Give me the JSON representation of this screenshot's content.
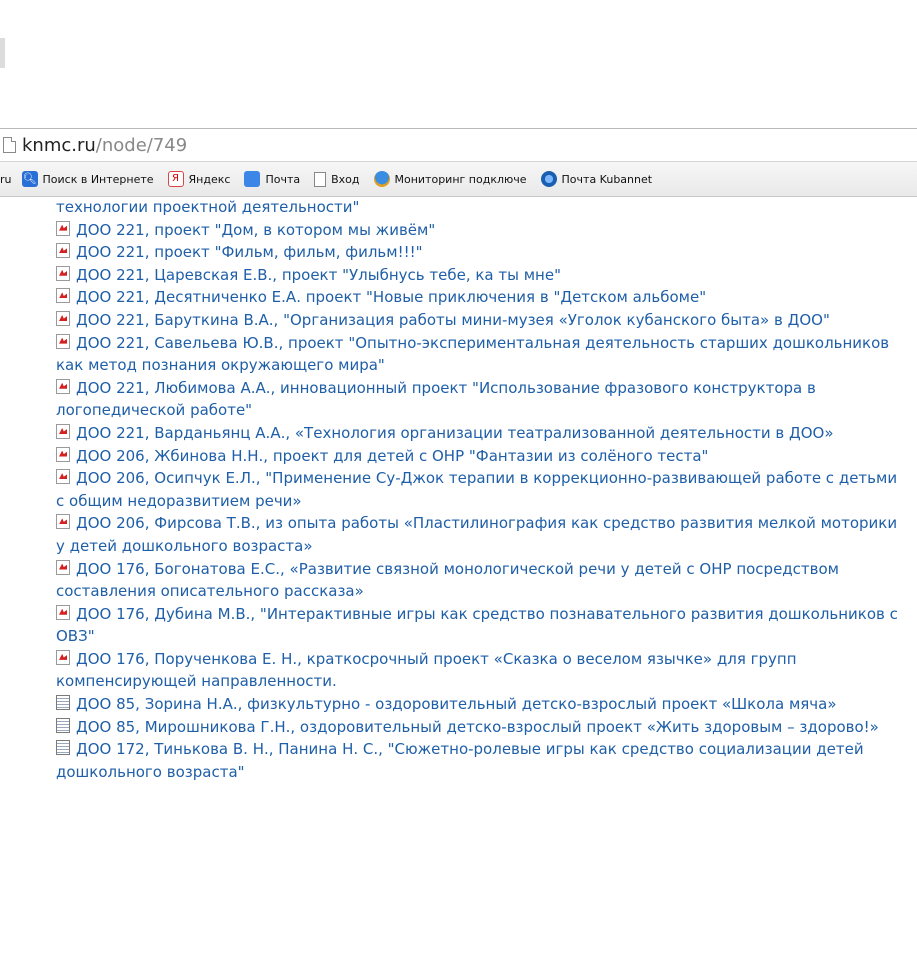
{
  "address_bar": {
    "domain": "knmc.ru",
    "path": "/node/749"
  },
  "bookmarks": {
    "left_fragment": "ru",
    "items": [
      {
        "label": "Поиск в Интернете",
        "icon": "search-icon"
      },
      {
        "label": "Яндекс",
        "icon": "yandex-icon",
        "glyph": "Я"
      },
      {
        "label": "Почта",
        "icon": "mail-icon"
      },
      {
        "label": "Вход",
        "icon": "page-icon"
      },
      {
        "label": "Мониторинг подключе",
        "icon": "monitoring-icon"
      },
      {
        "label": "Почта Kubannet",
        "icon": "kubannet-mail-icon"
      }
    ]
  },
  "content": {
    "lead_line": "технологии проектной деятельности\"",
    "items": [
      {
        "icon": "pdf-icon",
        "text": "ДОО 221, проект \"Дом, в котором мы живём\""
      },
      {
        "icon": "pdf-icon",
        "text": "ДОО 221, проект \"Фильм, фильм, фильм!!!\""
      },
      {
        "icon": "pdf-icon",
        "text": "ДОО 221, Царевская Е.В., проект \"Улыбнусь тебе, ка ты мне\""
      },
      {
        "icon": "pdf-icon",
        "text": "ДОО 221, Десятниченко Е.А. проект \"Новые приключения в \"Детском альбоме\""
      },
      {
        "icon": "pdf-icon",
        "text": "ДОО 221, Баруткина В.А., \"Организация работы мини-музея «Уголок кубанского быта» в ДОО\""
      },
      {
        "icon": "pdf-icon",
        "text": "ДОО 221, Савельева Ю.В., проект \"Опытно-экспериментальная деятельность старших дошкольников как метод познания окружающего мира\""
      },
      {
        "icon": "pdf-icon",
        "text": "ДОО 221, Любимова А.А., инновационный проект \"Использование фразового конструктора в логопедической работе\""
      },
      {
        "icon": "pdf-icon",
        "text": "ДОО 221, Варданьянц А.А., «Технология организации театрализованной деятельности в ДОО»"
      },
      {
        "icon": "pdf-icon",
        "text": "ДОО 206, Жбинова Н.Н., проект для детей с ОНР \"Фантазии из солёного теста\""
      },
      {
        "icon": "pdf-icon",
        "text": "ДОО 206, Осипчук Е.Л., \"Применение Су-Джок терапии в коррекционно-развивающей работе с детьми с общим недоразвитием речи»"
      },
      {
        "icon": "pdf-icon",
        "text": "ДОО 206, Фирсова Т.В., из опыта работы «Пластилинография как средство развития мелкой моторики у детей дошкольного возраста»"
      },
      {
        "icon": "pdf-icon",
        "text": "ДОО 176, Богонатова Е.С., «Развитие связной монологической речи у детей с ОНР посредством составления описательного рассказа»"
      },
      {
        "icon": "pdf-icon",
        "text": "ДОО 176, Дубина М.В., \"Интерактивные игры как средство познавательного развития дошкольников с ОВЗ\""
      },
      {
        "icon": "pdf-icon",
        "text": "ДОО 176, Порученкова Е. Н., краткосрочный проект «Сказка о веселом язычке» для групп компенсирующей направленности."
      },
      {
        "icon": "doc-icon",
        "text": "ДОО 85, Зорина Н.А., физкультурно - оздоровительный детско-взрослый проект «Школа мяча»"
      },
      {
        "icon": "doc-icon",
        "text": "ДОО 85, Мирошникова Г.Н., оздоровительный детско-взрослый проект «Жить здоровым – здорово!»"
      },
      {
        "icon": "doc-icon",
        "text": "ДОО 172, Тинькова В. Н., Панина Н. С., \"Сюжетно-ролевые игры как средство социализации детей дошкольного возраста\""
      }
    ]
  }
}
